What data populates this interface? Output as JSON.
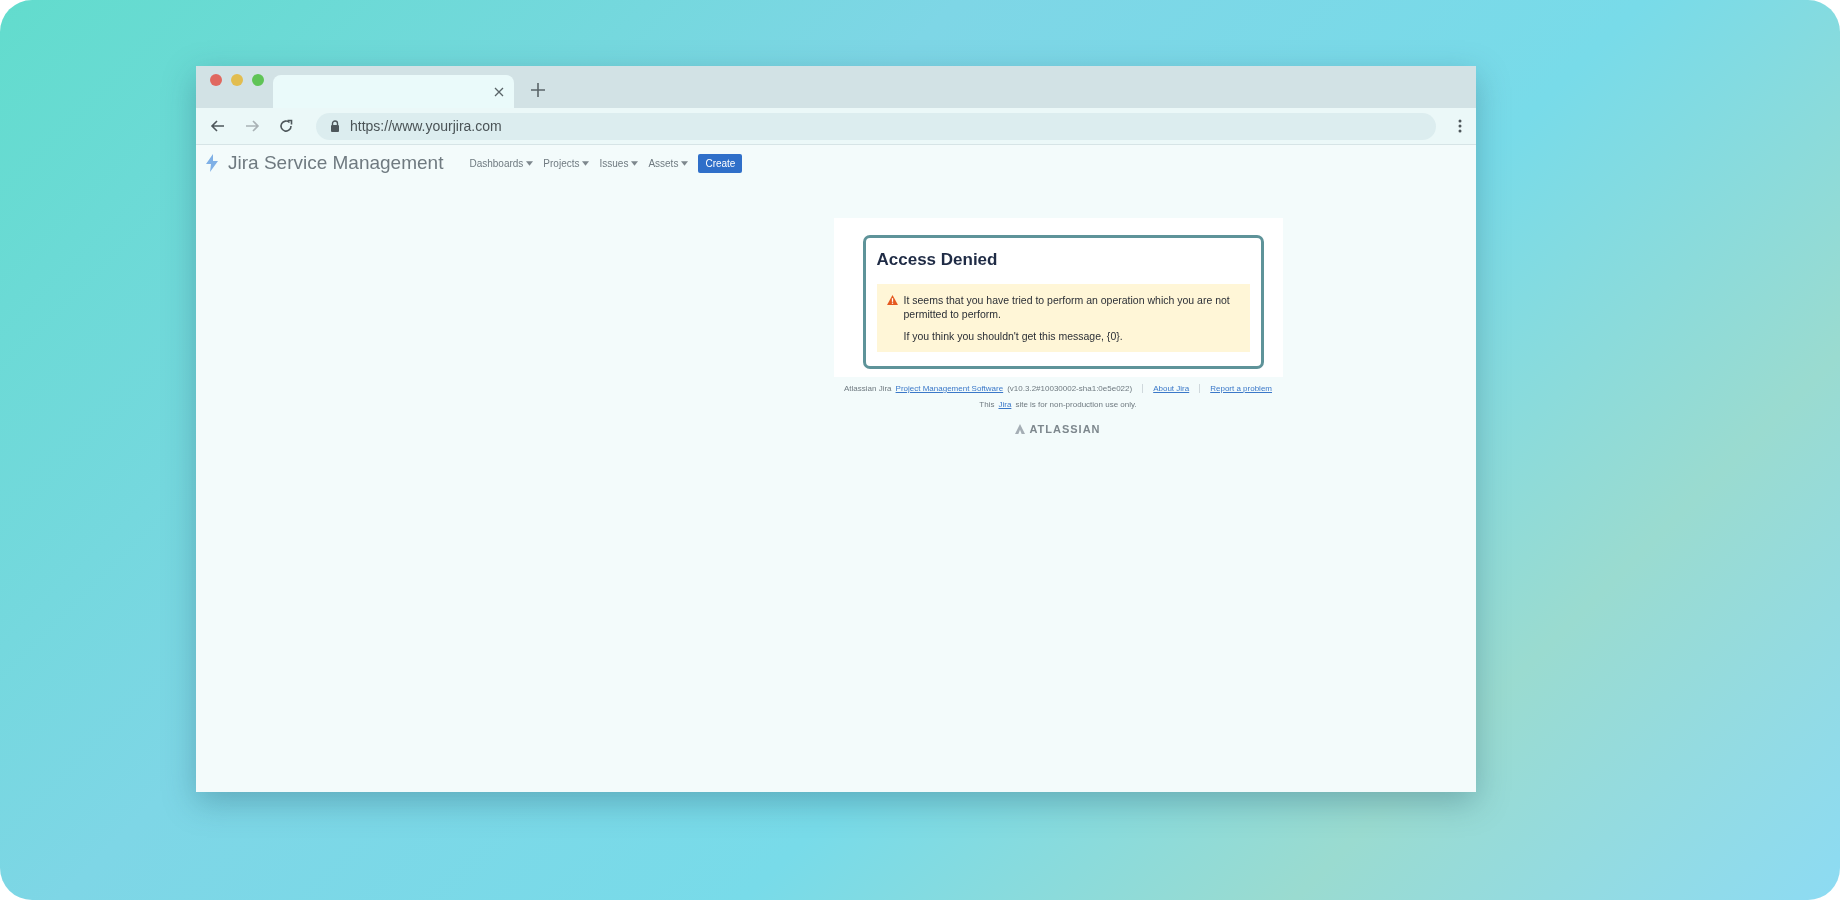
{
  "browser": {
    "url": "https://www.yourjira.com"
  },
  "header": {
    "product": "Jira Service Management",
    "menus": [
      {
        "label": "Dashboards"
      },
      {
        "label": "Projects"
      },
      {
        "label": "Issues"
      },
      {
        "label": "Assets"
      }
    ],
    "create": "Create"
  },
  "message": {
    "title": "Access Denied",
    "lines": [
      "It seems that you have tried to perform an operation which you are not permitted to perform.",
      "If you think you shouldn't get this message, {0}."
    ]
  },
  "footer": {
    "prefix": "Atlassian Jira",
    "link": "Project Management Software",
    "version": "(v10.3.2#10030002-sha1:0e5e022)",
    "about": "About Jira",
    "report": "Report a problem",
    "notice_before": "This",
    "notice_link": "Jira",
    "notice_after": "site is for non-production use only.",
    "brand": "ATLASSIAN"
  }
}
